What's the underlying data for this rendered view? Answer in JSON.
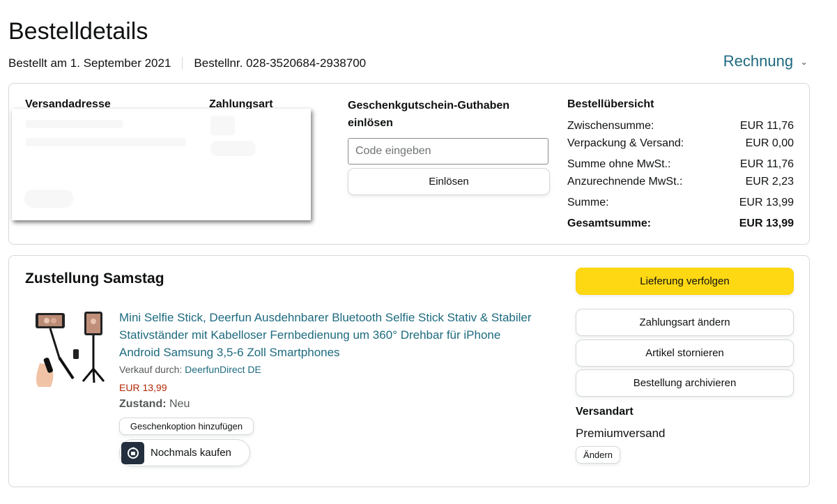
{
  "header": {
    "title": "Bestelldetails",
    "order_date": "Bestellt am 1. September 2021",
    "order_number": "Bestellnr. 028-3520684-2938700",
    "invoice_label": "Rechnung"
  },
  "summary_box": {
    "shipping_address_heading": "Versandadresse",
    "payment_method_heading": "Zahlungsart",
    "gift_card": {
      "heading": "Geschenkgutschein-Guthaben einlösen",
      "placeholder": "Code eingeben",
      "redeem_label": "Einlösen"
    },
    "order_summary": {
      "heading": "Bestellübersicht",
      "rows": [
        {
          "label": "Zwischensumme:",
          "value": "EUR 11,76"
        },
        {
          "label": "Verpackung & Versand:",
          "value": "EUR 0,00"
        },
        {
          "label": "Summe ohne MwSt.:",
          "value": "EUR 11,76"
        },
        {
          "label": "Anzurechnende MwSt.:",
          "value": "EUR 2,23"
        },
        {
          "label": "Summe:",
          "value": "EUR 13,99"
        },
        {
          "label": "Gesamtsumme:",
          "value": "EUR 13,99"
        }
      ]
    }
  },
  "delivery": {
    "title": "Zustellung Samstag",
    "product": {
      "title": "Mini Selfie Stick, Deerfun Ausdehnbarer Bluetooth Selfie Stick Stativ & Stabiler Stativständer mit Kabelloser Fernbedienung um 360° Drehbar für iPhone Android Samsung 3,5-6 Zoll Smartphones",
      "seller_prefix": "Verkauf durch:",
      "seller_name": "DeerfunDirect DE",
      "price": "EUR 13,99",
      "condition_label": "Zustand:",
      "condition_value": "Neu",
      "gift_option_label": "Geschenkoption hinzufügen",
      "buy_again_label": "Nochmals kaufen"
    },
    "actions": {
      "track_label": "Lieferung verfolgen",
      "change_payment_label": "Zahlungsart ändern",
      "cancel_label": "Artikel stornieren",
      "archive_label": "Bestellung archivieren"
    },
    "shipping": {
      "heading": "Versandart",
      "value": "Premiumversand",
      "change_label": "Ändern"
    }
  },
  "colors": {
    "link": "#1d6a7f",
    "price": "#b12704",
    "primary_button": "#ffd814",
    "border": "#d5d9d9"
  }
}
